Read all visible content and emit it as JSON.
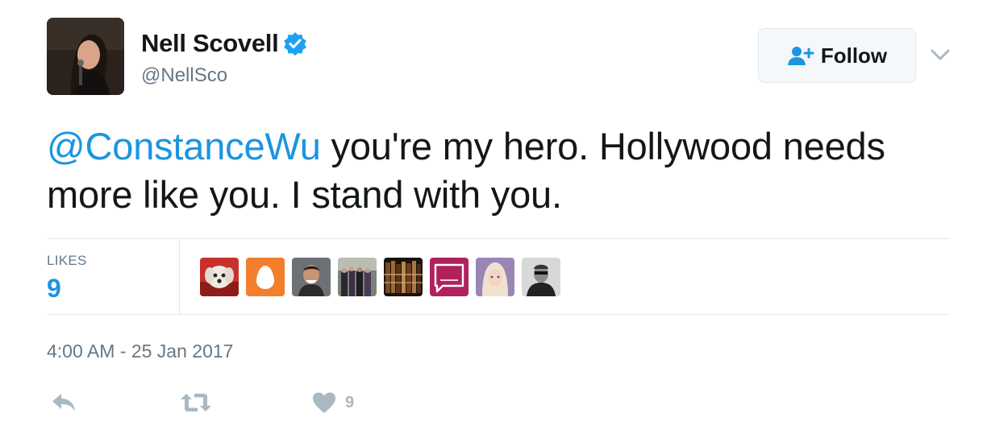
{
  "user": {
    "name": "Nell Scovell",
    "handle": "@NellSco",
    "verified": true,
    "avatar_icon": "profile-photo"
  },
  "follow_button": {
    "label": "Follow",
    "icon": "follow-person-icon"
  },
  "tweet": {
    "mention": "@ConstanceWu",
    "text_rest": " you're my hero. Hollywood needs more like you. I stand with you."
  },
  "likes": {
    "label": "LIKES",
    "count": "9"
  },
  "timestamp": "4:00 AM - 25 Jan 2017",
  "likers": [
    {
      "icon": "dog-photo",
      "color": "#c9302c"
    },
    {
      "icon": "egg-avatar",
      "color": "#f37e2b"
    },
    {
      "icon": "man-photo",
      "color": "#3a3a3a"
    },
    {
      "icon": "group-photo",
      "color": "#555b52"
    },
    {
      "icon": "books-photo",
      "color": "#5a3418"
    },
    {
      "icon": "standwithpp-badge",
      "color": "#b0215e"
    },
    {
      "icon": "woman-photo",
      "color": "#9a86b6"
    },
    {
      "icon": "bw-man-photo",
      "color": "#4a4a4a"
    }
  ],
  "actions": {
    "reply_icon": "reply-icon",
    "retweet_icon": "retweet-icon",
    "like_icon": "heart-icon",
    "like_count": "9"
  },
  "colors": {
    "accent": "#1b95e0",
    "muted": "#657786",
    "icon_gray": "#aab8c2",
    "border": "#e1e8ed"
  }
}
